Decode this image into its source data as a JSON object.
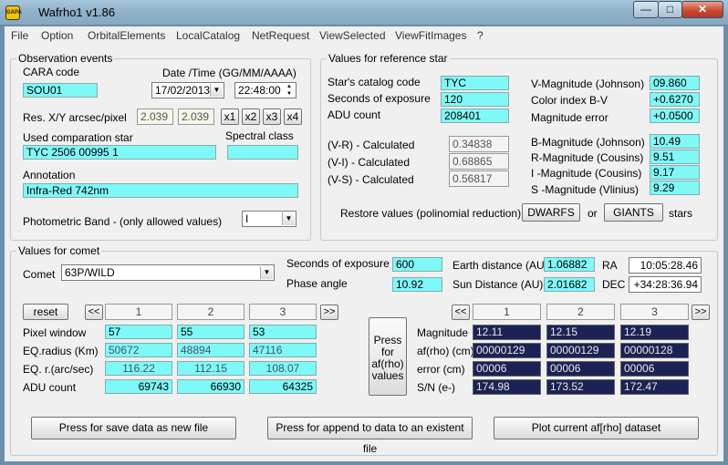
{
  "window": {
    "title": "Wafrho1 v1.86",
    "app_icon_text": "GAPA"
  },
  "menu": [
    "File",
    "Option",
    "OrbitalElements",
    "LocalCatalog",
    "NetRequest",
    "ViewSelected",
    "ViewFitImages",
    "?"
  ],
  "obs": {
    "title": "Observation events",
    "cara_code_label": "CARA code",
    "cara_code": "SOU01",
    "datetime_label": "Date /Time  (GG/MM/AAAA)",
    "date": "17/02/2013",
    "time": "22:48:00",
    "res_label": "Res. X/Y arcsec/pixel",
    "res_x": "2.039",
    "res_y": "2.039",
    "zoom": [
      "x1",
      "x2",
      "x3",
      "x4"
    ],
    "comparison_label": "Used comparation star",
    "comparison_star": "TYC 2506 00995 1",
    "spectral_label": "Spectral class",
    "spectral_class": "",
    "annotation_label": "Annotation",
    "annotation": "Infra-Red 742nm",
    "band_label": "Photometric Band  - (only allowed values)",
    "band": "I"
  },
  "ref": {
    "title": "Values for reference star",
    "catalog_label": "Star's catalog code",
    "catalog": "TYC",
    "exposure_label": "Seconds of exposure",
    "exposure": "120",
    "adu_label": "ADU count",
    "adu": "208401",
    "vr_label": "(V-R) - Calculated",
    "vr": "0.34838",
    "vi_label": "(V-I) - Calculated",
    "vi": "0.68865",
    "vs_label": "(V-S) - Calculated",
    "vs": "0.56817",
    "vmag_label": "V-Magnitude (Johnson)",
    "vmag": "09.860",
    "bv_label": "Color index B-V",
    "bv": "+0.6270",
    "magerr_label": "Magnitude error",
    "magerr": "+0.0500",
    "bmag_label": "B-Magnitude (Johnson)",
    "bmag": "10.49",
    "rmag_label": "R-Magnitude (Cousins)",
    "rmag": "9.51",
    "imag_label": "I -Magnitude (Cousins)",
    "imag": "9.17",
    "smag_label": "S -Magnitude (Vlinius)",
    "smag": "9.29",
    "restore_label": "Restore values (polinomial reduction) for",
    "dwarfs": "DWARFS",
    "or": "or",
    "giants": "GIANTS",
    "stars": "stars"
  },
  "comet": {
    "title": "Values for comet",
    "comet_label": "Comet",
    "comet_name": "63P/WILD",
    "exposure_label": "Seconds of exposure",
    "exposure": "600",
    "phase_label": "Phase angle",
    "phase": "10.92",
    "earth_label": "Earth distance (AU)",
    "earth": "1.06882",
    "sun_label": "Sun Distance (AU)",
    "sun": "2.01682",
    "ra_label": "RA",
    "ra": "10:05:28.46",
    "dec_label": "DEC",
    "dec": "+34:28:36.94",
    "reset": "reset",
    "prev": "<<",
    "next": ">>",
    "cols": [
      "1",
      "2",
      "3"
    ],
    "pixel_label": "Pixel window",
    "pixel": [
      "57",
      "55",
      "53"
    ],
    "eqrad_label": "EQ.radius (Km)",
    "eqrad": [
      "50672",
      "48894",
      "47116"
    ],
    "eqr_label": "EQ. r.(arc/sec)",
    "eqr": [
      "116.22",
      "112.15",
      "108.07"
    ],
    "adu_label": "ADU count",
    "adu": [
      "69743",
      "66930",
      "64325"
    ],
    "press_btn": "Press for af(rho) values",
    "mag_label": "Magnitude",
    "mag": [
      "12.11",
      "12.15",
      "12.19"
    ],
    "afrho_label": "af(rho) (cm)",
    "afrho": [
      "00000129",
      "00000129",
      "00000128"
    ],
    "err_label": "error (cm)",
    "err": [
      "00006",
      "00006",
      "00006"
    ],
    "sn_label": "S/N (e-)",
    "sn": [
      "174.98",
      "173.52",
      "172.47"
    ]
  },
  "actions": {
    "save_new": "Press for save data as new file",
    "append": "Press for append to  data to an existent file",
    "plot": "Plot current af[rho] dataset"
  }
}
